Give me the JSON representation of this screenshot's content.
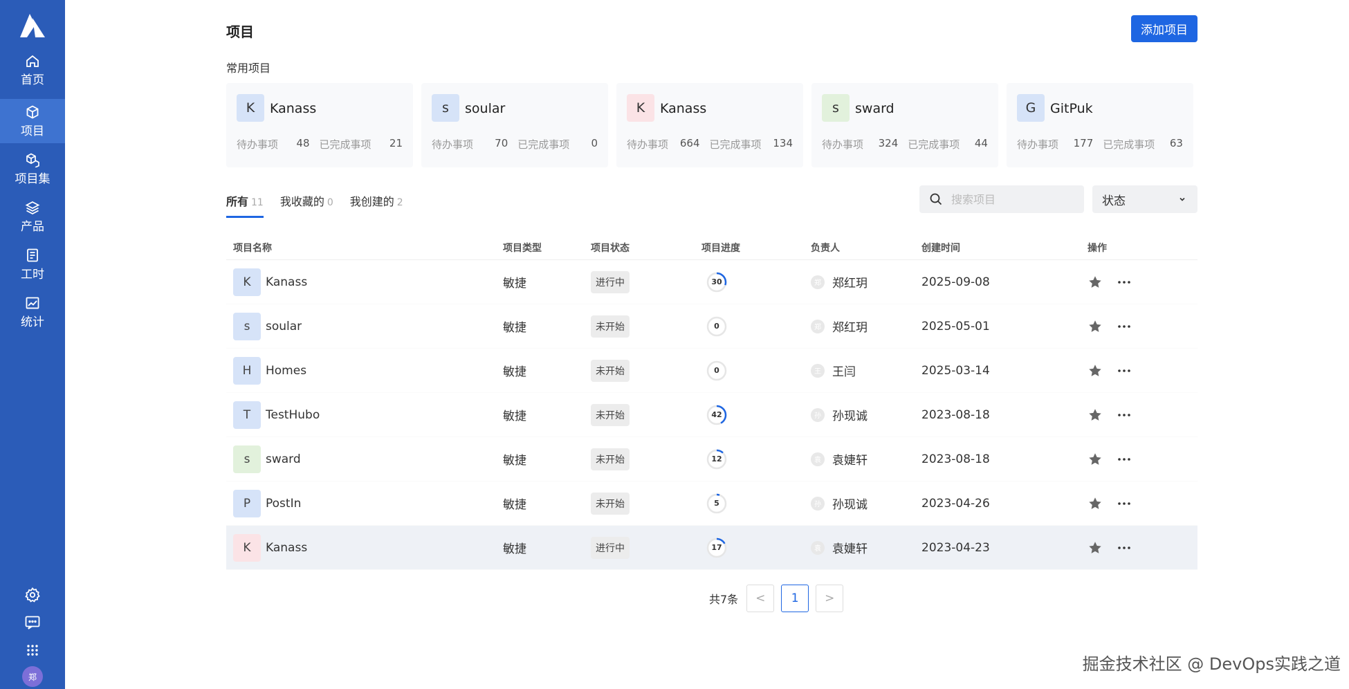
{
  "sidebar": {
    "items": [
      {
        "label": "首页",
        "icon": "home-icon"
      },
      {
        "label": "项目",
        "icon": "cube-icon"
      },
      {
        "label": "项目集",
        "icon": "cube-set-icon"
      },
      {
        "label": "产品",
        "icon": "layers-icon"
      },
      {
        "label": "工时",
        "icon": "worklog-icon"
      },
      {
        "label": "统计",
        "icon": "chart-icon"
      }
    ],
    "active_index": 1,
    "avatar_text": "郑"
  },
  "header": {
    "title": "项目",
    "add_button": "添加项目"
  },
  "frequent": {
    "title": "常用项目",
    "cards": [
      {
        "initial": "K",
        "name": "Kanass",
        "todo_label": "待办事项",
        "todo": "48",
        "done_label": "已完成事项",
        "done": "21",
        "color": "#d6e3f8"
      },
      {
        "initial": "s",
        "name": "soular",
        "todo_label": "待办事项",
        "todo": "70",
        "done_label": "已完成事项",
        "done": "0",
        "color": "#d6e3f8"
      },
      {
        "initial": "K",
        "name": "Kanass",
        "todo_label": "待办事项",
        "todo": "664",
        "done_label": "已完成事项",
        "done": "134",
        "color": "#fbe3e6"
      },
      {
        "initial": "s",
        "name": "sward",
        "todo_label": "待办事项",
        "todo": "324",
        "done_label": "已完成事项",
        "done": "44",
        "color": "#e2f1dc"
      },
      {
        "initial": "G",
        "name": "GitPuk",
        "todo_label": "待办事项",
        "todo": "177",
        "done_label": "已完成事项",
        "done": "63",
        "color": "#d6e3f8"
      }
    ]
  },
  "tabs": [
    {
      "label": "所有",
      "count": "11"
    },
    {
      "label": "我收藏的",
      "count": "0"
    },
    {
      "label": "我创建的",
      "count": "2"
    }
  ],
  "search": {
    "placeholder": "搜索项目"
  },
  "status_filter": {
    "label": "状态"
  },
  "table": {
    "headers": [
      "项目名称",
      "项目类型",
      "项目状态",
      "项目进度",
      "负责人",
      "创建时间",
      "操作"
    ],
    "rows": [
      {
        "initial": "K",
        "name": "Kanass",
        "type": "敏捷",
        "status": "进行中",
        "progress": 30,
        "progress_text": "30",
        "owner": "郑红玥",
        "owner_initial": "郑",
        "created": "2025-09-08",
        "color": "#d6e3f8"
      },
      {
        "initial": "s",
        "name": "soular",
        "type": "敏捷",
        "status": "未开始",
        "progress": 0,
        "progress_text": "0",
        "owner": "郑红玥",
        "owner_initial": "郑",
        "created": "2025-05-01",
        "color": "#d6e3f8"
      },
      {
        "initial": "H",
        "name": "Homes",
        "type": "敏捷",
        "status": "未开始",
        "progress": 0,
        "progress_text": "0",
        "owner": "王闫",
        "owner_initial": "王",
        "created": "2025-03-14",
        "color": "#d6e3f8"
      },
      {
        "initial": "T",
        "name": "TestHubo",
        "type": "敏捷",
        "status": "未开始",
        "progress": 42,
        "progress_text": "42",
        "owner": "孙现诚",
        "owner_initial": "孙",
        "created": "2023-08-18",
        "color": "#d6e3f8"
      },
      {
        "initial": "s",
        "name": "sward",
        "type": "敏捷",
        "status": "未开始",
        "progress": 12,
        "progress_text": "12",
        "owner": "袁婕轩",
        "owner_initial": "袁",
        "created": "2023-08-18",
        "color": "#e2f1dc"
      },
      {
        "initial": "P",
        "name": "PostIn",
        "type": "敏捷",
        "status": "未开始",
        "progress": 5,
        "progress_text": "5",
        "owner": "孙现诚",
        "owner_initial": "孙",
        "created": "2023-04-26",
        "color": "#d6e3f8"
      },
      {
        "initial": "K",
        "name": "Kanass",
        "type": "敏捷",
        "status": "进行中",
        "progress": 17,
        "progress_text": "17",
        "owner": "袁婕轩",
        "owner_initial": "袁",
        "created": "2023-04-23",
        "color": "#fbe3e6"
      }
    ]
  },
  "pagination": {
    "total": "共7条",
    "prev": "<",
    "page": "1",
    "next": ">"
  },
  "watermark": "掘金技术社区 @ DevOps实践之道",
  "colors": {
    "sidebar": "#2b5cb8",
    "accent": "#1e66e2"
  }
}
